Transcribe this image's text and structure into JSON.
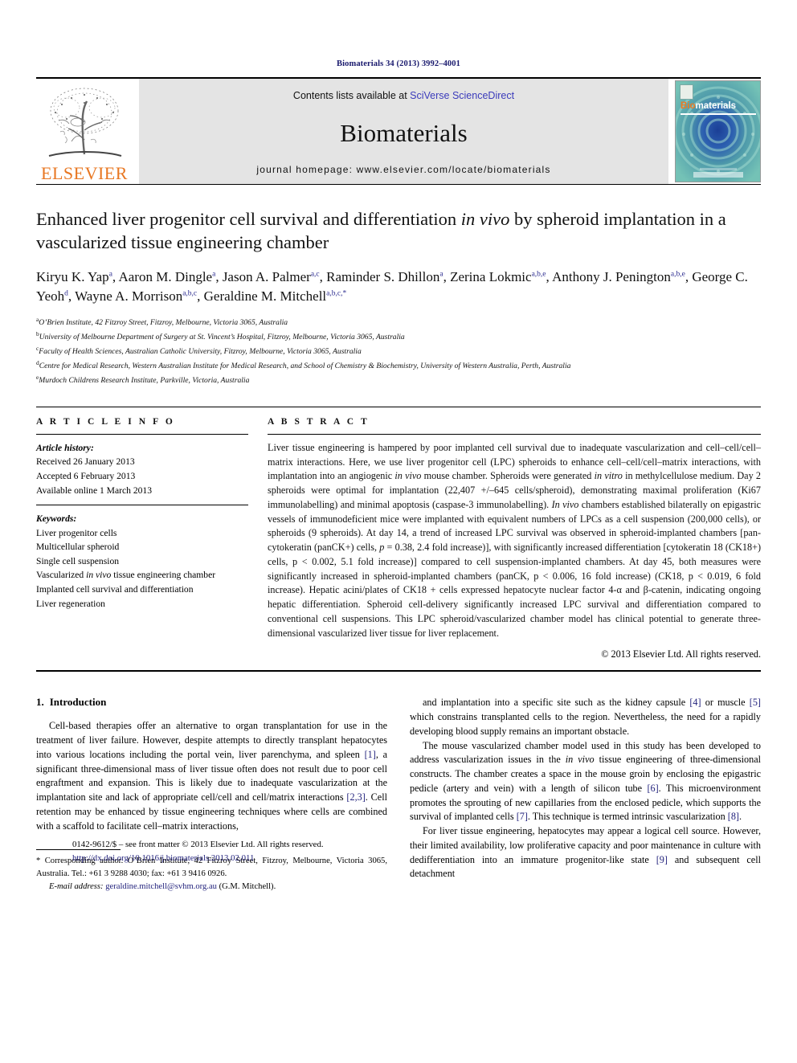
{
  "running_head": "Biomaterials 34 (2013) 3992–4001",
  "masthead": {
    "publisher_name": "ELSEVIER",
    "contents_prefix": "Contents lists available at ",
    "contents_link": "SciVerse ScienceDirect",
    "journal_name": "Biomaterials",
    "homepage": "journal homepage: www.elsevier.com/locate/biomaterials",
    "cover": {
      "title_bio": "Bio",
      "title_materials": "materials"
    },
    "colors": {
      "link": "#3b3bbb",
      "elsevier_orange": "#E87722",
      "band": "#e4e4e4",
      "cover_teal": "#5fb6ae"
    }
  },
  "title": {
    "part1": "Enhanced liver progenitor cell survival and differentiation ",
    "italic": "in vivo",
    "part2": " by spheroid implantation in a vascularized tissue engineering chamber"
  },
  "authors": [
    {
      "name": "Kiryu K. Yap",
      "sup": "a",
      "sep": ", "
    },
    {
      "name": "Aaron M. Dingle",
      "sup": "a",
      "sep": ", "
    },
    {
      "name": "Jason A. Palmer",
      "sup": "a,c",
      "sep": ", "
    },
    {
      "name": "Raminder S. Dhillon",
      "sup": "a",
      "sep": ", "
    },
    {
      "name": "Zerina Lokmic",
      "sup": "a,b,e",
      "sep": ", "
    },
    {
      "name": "Anthony J. Penington",
      "sup": "a,b,e",
      "sep": ", "
    },
    {
      "name": "George C. Yeoh",
      "sup": "d",
      "sep": ", "
    },
    {
      "name": "Wayne A. Morrison",
      "sup": "a,b,c",
      "sep": ", "
    },
    {
      "name": "Geraldine M. Mitchell",
      "sup": "a,b,c,*",
      "sep": ""
    }
  ],
  "affiliations": [
    {
      "mark": "a",
      "text": "O’Brien Institute, 42 Fitzroy Street, Fitzroy, Melbourne, Victoria 3065, Australia"
    },
    {
      "mark": "b",
      "text": "University of Melbourne Department of Surgery at St. Vincent’s Hospital, Fitzroy, Melbourne, Victoria 3065, Australia"
    },
    {
      "mark": "c",
      "text": "Faculty of Health Sciences, Australian Catholic University, Fitzroy, Melbourne, Victoria 3065, Australia"
    },
    {
      "mark": "d",
      "text": "Centre for Medical Research, Western Australian Institute for Medical Research, and School of Chemistry & Biochemistry, University of Western Australia, Perth, Australia"
    },
    {
      "mark": "e",
      "text": "Murdoch Childrens Research Institute, Parkville, Victoria, Australia"
    }
  ],
  "article_info": {
    "heading": "A R T I C L E   I N F O",
    "history_label": "Article history:",
    "history": [
      "Received 26 January 2013",
      "Accepted 6 February 2013",
      "Available online 1 March 2013"
    ],
    "keywords_label": "Keywords:",
    "keywords": [
      "Liver progenitor cells",
      "Multicellular spheroid",
      "Single cell suspension",
      "Vascularized in vivo tissue engineering chamber",
      "Implanted cell survival and differentiation",
      "Liver regeneration"
    ]
  },
  "abstract": {
    "heading": "A B S T R A C T",
    "text": "Liver tissue engineering is hampered by poor implanted cell survival due to inadequate vascularization and cell–cell/cell–matrix interactions. Here, we use liver progenitor cell (LPC) spheroids to enhance cell–cell/cell–matrix interactions, with implantation into an angiogenic in vivo mouse chamber. Spheroids were generated in vitro in methylcellulose medium. Day 2 spheroids were optimal for implantation (22,407 +/–645 cells/spheroid), demonstrating maximal proliferation (Ki67 immunolabelling) and minimal apoptosis (caspase-3 immunolabelling). In vivo chambers established bilaterally on epigastric vessels of immunodeficient mice were implanted with equivalent numbers of LPCs as a cell suspension (200,000 cells), or spheroids (9 spheroids). At day 14, a trend of increased LPC survival was observed in spheroid-implanted chambers [pan-cytokeratin (panCK+) cells, p = 0.38, 2.4 fold increase)], with significantly increased differentiation [cytokeratin 18 (CK18+) cells, p < 0.002, 5.1 fold increase)] compared to cell suspension-implanted chambers. At day 45, both measures were significantly increased in spheroid-implanted chambers (panCK, p < 0.006, 16 fold increase) (CK18, p < 0.019, 6 fold increase). Hepatic acini/plates of CK18 + cells expressed hepatocyte nuclear factor 4-α and β-catenin, indicating ongoing hepatic differentiation. Spheroid cell-delivery significantly increased LPC survival and differentiation compared to conventional cell suspensions. This LPC spheroid/vascularized chamber model has clinical potential to generate three-dimensional vascularized liver tissue for liver replacement.",
    "copyright": "© 2013 Elsevier Ltd. All rights reserved."
  },
  "introduction": {
    "number": "1.",
    "heading": "Introduction",
    "left_paragraphs": [
      "Cell-based therapies offer an alternative to organ transplantation for use in the treatment of liver failure. However, despite attempts to directly transplant hepatocytes into various locations including the portal vein, liver parenchyma, and spleen [1], a significant three-dimensional mass of liver tissue often does not result due to poor cell engraftment and expansion. This is likely due to inadequate vascularization at the implantation site and lack of appropriate cell/cell and cell/matrix interactions [2,3]. Cell retention may be enhanced by tissue engineering techniques where cells are combined with a scaffold to facilitate cell–matrix interactions,"
    ],
    "right_paragraphs": [
      "and implantation into a specific site such as the kidney capsule [4] or muscle [5] which constrains transplanted cells to the region. Nevertheless, the need for a rapidly developing blood supply remains an important obstacle.",
      "The mouse vascularized chamber model used in this study has been developed to address vascularization issues in the in vivo tissue engineering of three-dimensional constructs. The chamber creates a space in the mouse groin by enclosing the epigastric pedicle (artery and vein) with a length of silicon tube [6]. This microenvironment promotes the sprouting of new capillaries from the enclosed pedicle, which supports the survival of implanted cells [7]. This technique is termed intrinsic vascularization [8].",
      "For liver tissue engineering, hepatocytes may appear a logical cell source. However, their limited availability, low proliferative capacity and poor maintenance in culture with dedifferentiation into an immature progenitor-like state [9] and subsequent cell detachment"
    ]
  },
  "footnote": {
    "corresponding": "* Corresponding author. O’Brien Institute, 42 Fitzroy Street, Fitzroy, Melbourne, Victoria 3065, Australia. Tel.: +61 3 9288 4030; fax: +61 3 9416 0926.",
    "email_label": "E-mail address:",
    "email": "geraldine.mitchell@svhm.org.au",
    "email_owner": "(G.M. Mitchell)."
  },
  "footer": {
    "front_matter": "0142-9612/$ – see front matter © 2013 Elsevier Ltd. All rights reserved.",
    "doi": "http://dx.doi.org/10.1016/j.biomaterials.2013.02.011"
  }
}
